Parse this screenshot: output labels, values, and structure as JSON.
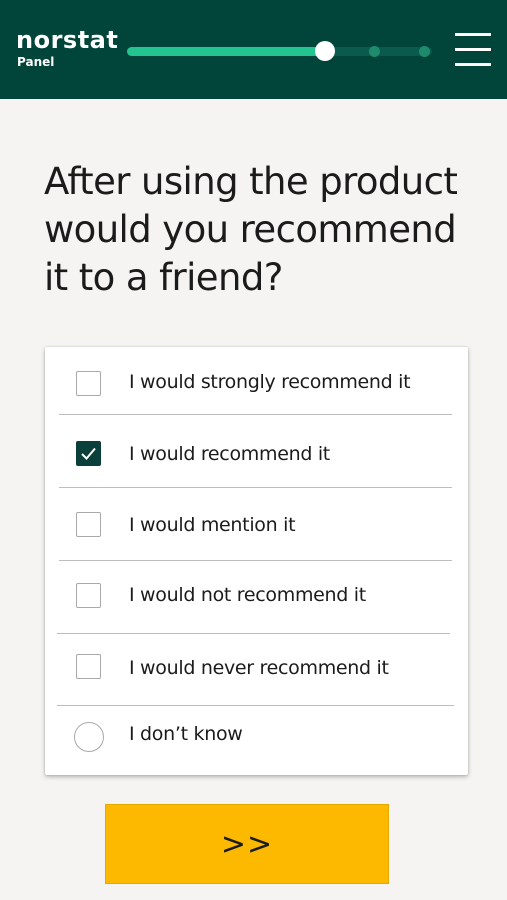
{
  "header": {
    "logo_name": "norstat",
    "logo_sub": "Panel",
    "progress": {
      "fraction": 0.65,
      "remaining_steps": 2
    },
    "menu_icon": "hamburger-menu-icon"
  },
  "question": {
    "text": "After using the product would you recommend it to a friend?"
  },
  "options": [
    {
      "label": "I would strongly recommend it",
      "type": "checkbox",
      "checked": false
    },
    {
      "label": "I would recommend it",
      "type": "checkbox",
      "checked": true
    },
    {
      "label": "I would mention it",
      "type": "checkbox",
      "checked": false
    },
    {
      "label": "I would not recommend it",
      "type": "checkbox",
      "checked": false
    },
    {
      "label": "I would never recommend it",
      "type": "checkbox",
      "checked": false
    },
    {
      "label": "I don’t know",
      "type": "radio",
      "checked": false
    }
  ],
  "next_button": {
    "label": ">>"
  },
  "colors": {
    "header_bg": "#00443a",
    "progress_fill": "#23c48f",
    "checkbox_checked": "#0b3f3a",
    "button_bg": "#fcb900"
  }
}
